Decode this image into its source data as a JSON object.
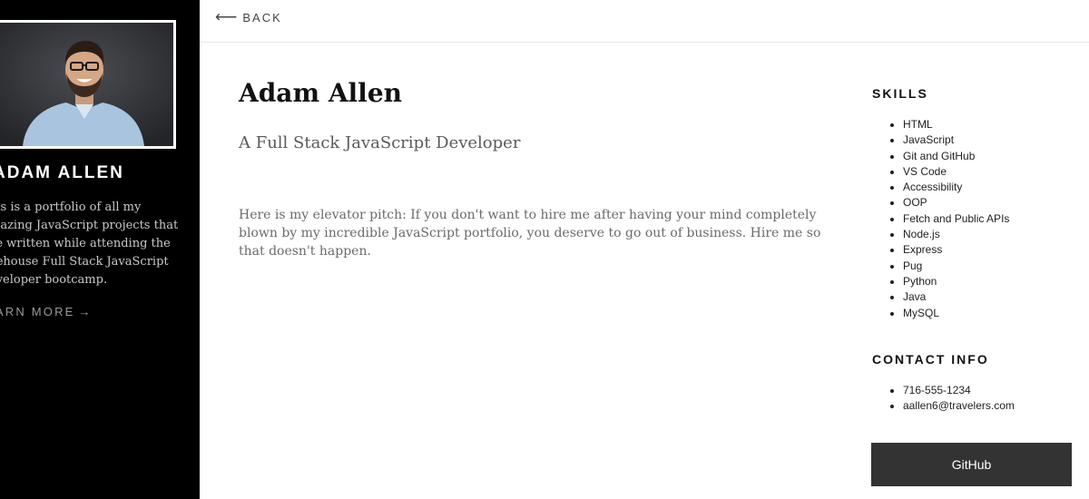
{
  "sidebar": {
    "name": "ADAM ALLEN",
    "bio": "his is a portfolio of all my mazing JavaScript projects that ve written while attending the eehouse Full Stack JavaScript eveloper bootcamp.",
    "learn_more": "EARN MORE",
    "learn_more_icon": "arrow-right-icon"
  },
  "topbar": {
    "back_label": "BACK",
    "back_icon": "arrow-left-icon"
  },
  "main": {
    "title": "Adam Allen",
    "subtitle": "A Full Stack JavaScript Developer",
    "pitch": "Here is my elevator pitch: If you don't want to hire me after having your mind completely blown by my incredible JavaScript portfolio, you deserve to go out of business. Hire me so that doesn't happen."
  },
  "skills": {
    "heading": "SKILLS",
    "items": [
      "HTML",
      "JavaScript",
      "Git and GitHub",
      "VS Code",
      "Accessibility",
      "OOP",
      "Fetch and Public APIs",
      "Node.js",
      "Express",
      "Pug",
      "Python",
      "Java",
      "MySQL"
    ]
  },
  "contact": {
    "heading": "CONTACT INFO",
    "items": [
      "716-555-1234",
      "aallen6@travelers.com"
    ]
  },
  "github_button": {
    "label": "GitHub"
  },
  "colors": {
    "sidebar_bg": "#000000",
    "button_bg": "#333333",
    "page_bg": "#ffffff"
  }
}
